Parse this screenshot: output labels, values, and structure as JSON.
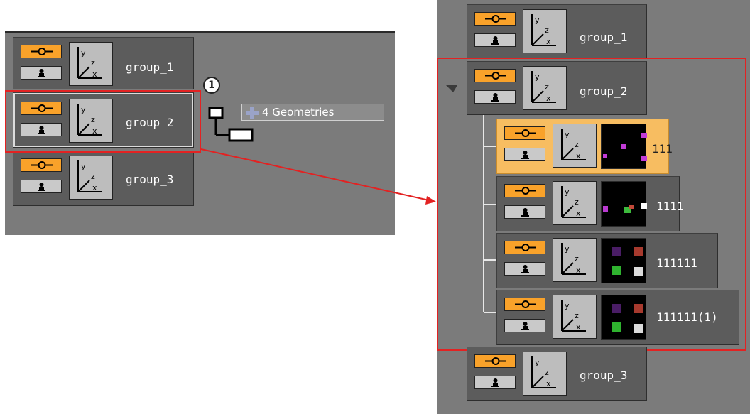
{
  "left": {
    "groups": [
      {
        "label": "group_1"
      },
      {
        "label": "group_2"
      },
      {
        "label": "group_3"
      }
    ],
    "callout_number": "1",
    "geometries_label": "4 Geometries"
  },
  "right": {
    "groups": [
      {
        "label": "group_1"
      },
      {
        "label": "group_2"
      },
      {
        "label": "group_3"
      }
    ],
    "children": [
      {
        "label": "111"
      },
      {
        "label": "1111"
      },
      {
        "label": "111111"
      },
      {
        "label": "111111(1)"
      }
    ]
  },
  "colors": {
    "visibility_button": "#f9a22a",
    "selected_node": "#f7bd61",
    "highlight_frame": "#e32222",
    "panel_background": "#7b7b7b"
  },
  "icons": {
    "visibility": "eye-icon",
    "lock": "pawn-lock-icon",
    "axis": "axis-xyz-icon",
    "expand": "expand-triangle-icon",
    "geometries": "plus-icon",
    "hierarchy": "hierarchy-icon"
  }
}
